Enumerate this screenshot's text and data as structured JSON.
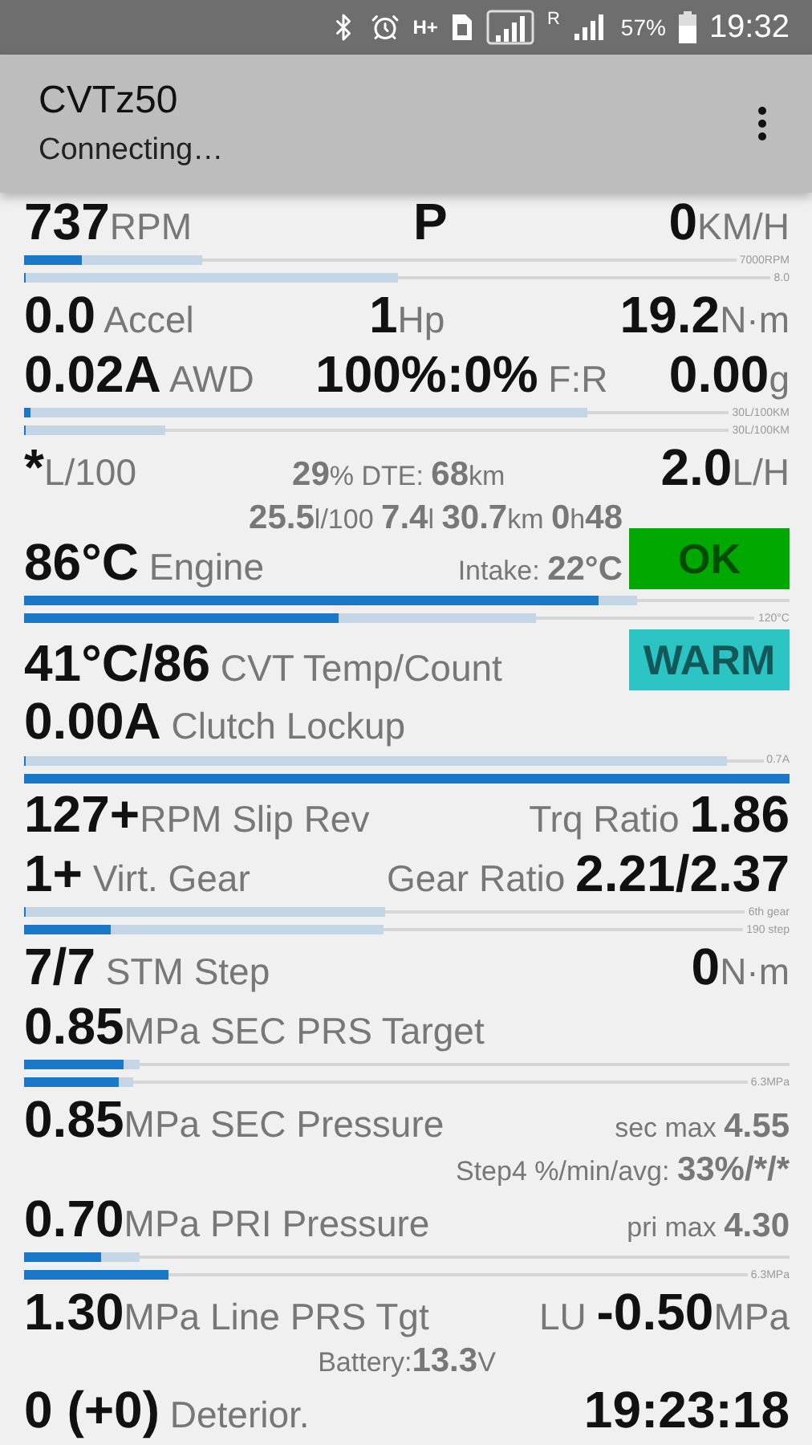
{
  "status_bar": {
    "network": "H+",
    "roaming": "R",
    "battery": "57%",
    "time": "19:32"
  },
  "app_bar": {
    "title": "CVTz50",
    "subtitle": "Connecting…"
  },
  "lines": [
    {
      "kind": "text",
      "left": [
        {
          "text": "737",
          "kind": "value"
        },
        {
          "text": "RPM",
          "kind": "unit"
        }
      ],
      "center": [
        {
          "text": "P",
          "kind": "value"
        }
      ],
      "right": [
        {
          "text": "0",
          "kind": "value"
        },
        {
          "text": "KM/H",
          "kind": "unit"
        }
      ]
    },
    {
      "kind": "bars",
      "bars": [
        {
          "peak": {
            "level": 0.25
          },
          "current": {
            "level": 0.08
          },
          "caption": "7000RPM"
        },
        {
          "peak": {
            "level": 0.5
          },
          "current": {
            "level": 0
          },
          "caption": "8.0"
        }
      ]
    },
    {
      "kind": "text",
      "left": [
        {
          "text": "0.0",
          "kind": "value"
        },
        {
          "text": " Accel",
          "kind": "unit"
        }
      ],
      "center": [
        {
          "text": "1",
          "kind": "value"
        },
        {
          "text": "Hp",
          "kind": "unit"
        }
      ],
      "right": [
        {
          "text": "19.2",
          "kind": "value"
        },
        {
          "text": "N·m",
          "kind": "unit"
        }
      ]
    },
    {
      "kind": "text",
      "left": [
        {
          "text": "0.02A",
          "kind": "value"
        },
        {
          "text": " AWD",
          "kind": "unit"
        }
      ],
      "center": [
        {
          "text": "100%:0%",
          "kind": "value"
        },
        {
          "text": " F:R",
          "kind": "unit"
        }
      ],
      "right": [
        {
          "text": "0.00",
          "kind": "value"
        },
        {
          "text": "g",
          "kind": "unit"
        }
      ]
    },
    {
      "kind": "bars",
      "bars": [
        {
          "peak": {
            "level": 0.8
          },
          "current": {
            "level": 0.01
          },
          "caption": "30L/100KM"
        },
        {
          "peak": {
            "level": 0.2
          },
          "current": {
            "level": 0
          },
          "caption": "30L/100KM"
        }
      ]
    },
    {
      "kind": "text",
      "left": [
        {
          "text": "*",
          "kind": "value"
        },
        {
          "text": "L/100",
          "kind": "unit"
        }
      ],
      "center": [
        {
          "text": "29",
          "kind": "small_value"
        },
        {
          "text": "% DTE: ",
          "kind": "small_unit"
        },
        {
          "text": "68",
          "kind": "small_value"
        },
        {
          "text": "km",
          "kind": "small_unit"
        }
      ],
      "right": [
        {
          "text": "2.0",
          "kind": "value"
        },
        {
          "text": "L/H",
          "kind": "unit"
        }
      ]
    },
    {
      "kind": "badged",
      "top": [
        {
          "text": "25.5",
          "kind": "small_value"
        },
        {
          "text": "l/100 ",
          "kind": "small_unit"
        },
        {
          "text": "7.4",
          "kind": "small_value"
        },
        {
          "text": "l ",
          "kind": "small_unit"
        },
        {
          "text": "30.7",
          "kind": "small_value"
        },
        {
          "text": "km ",
          "kind": "small_unit"
        },
        {
          "text": "0",
          "kind": "small_value"
        },
        {
          "text": "h",
          "kind": "small_unit"
        },
        {
          "text": "48",
          "kind": "small_value"
        }
      ],
      "left": [
        {
          "text": "86°C",
          "kind": "value"
        },
        {
          "text": " Engine",
          "kind": "unit"
        }
      ],
      "right": [
        {
          "text": "Intake: ",
          "kind": "small_unit"
        },
        {
          "text": "22°C",
          "kind": "small_value"
        }
      ],
      "badge": {
        "text": "OK",
        "color": "#00a800"
      }
    },
    {
      "kind": "bars",
      "bars": [
        {
          "peak": {
            "level": 0.8
          },
          "current": {
            "level": 0.75
          }
        },
        {
          "peak": {
            "level": 0.7
          },
          "current": {
            "level": 0.43
          },
          "caption": "120°C"
        }
      ]
    },
    {
      "kind": "badged",
      "left": [
        {
          "text": "41°C/86",
          "kind": "value"
        },
        {
          "text": " CVT Temp/Count",
          "kind": "unit"
        }
      ],
      "badge": {
        "text": "WARM",
        "color": "#2cc3c3"
      }
    },
    {
      "kind": "text",
      "left": [
        {
          "text": "0.00A",
          "kind": "value"
        },
        {
          "text": " Clutch Lockup",
          "kind": "unit"
        }
      ]
    },
    {
      "kind": "bars",
      "bars": [
        {
          "peak": {
            "level": 0.95
          },
          "current": {
            "level": 0
          },
          "caption": "0.7A"
        },
        {
          "current": {
            "level": 1
          }
        }
      ]
    },
    {
      "kind": "text",
      "left": [
        {
          "text": "127+",
          "kind": "value"
        },
        {
          "text": "RPM Slip Rev",
          "kind": "unit"
        }
      ],
      "right": [
        {
          "text": "Trq Ratio ",
          "kind": "unit"
        },
        {
          "text": "1.86",
          "kind": "value"
        }
      ]
    },
    {
      "kind": "text",
      "left": [
        {
          "text": "1+",
          "kind": "value"
        },
        {
          "text": " Virt. Gear",
          "kind": "unit"
        }
      ],
      "right": [
        {
          "text": "Gear Ratio ",
          "kind": "unit"
        },
        {
          "text": "2.21/2.37",
          "kind": "value"
        }
      ]
    },
    {
      "kind": "bars",
      "bars": [
        {
          "peak": {
            "level": 0.5
          },
          "current": {
            "level": 0
          },
          "caption": "6th gear"
        },
        {
          "peak": {
            "level": 0.5
          },
          "current": {
            "level": 0.12
          },
          "caption": "190 step"
        }
      ]
    },
    {
      "kind": "text",
      "left": [
        {
          "text": "7/7",
          "kind": "value"
        },
        {
          "text": " STM Step",
          "kind": "unit"
        }
      ],
      "right": [
        {
          "text": "0",
          "kind": "value"
        },
        {
          "text": "N·m",
          "kind": "unit"
        }
      ]
    },
    {
      "kind": "text",
      "left": [
        {
          "text": "0.85",
          "kind": "value"
        },
        {
          "text": "MPa SEC PRS Target",
          "kind": "unit"
        }
      ]
    },
    {
      "kind": "bars",
      "bars": [
        {
          "peak": {
            "level": 0.15
          },
          "current": {
            "level": 0.13
          }
        },
        {
          "peak": {
            "level": 0.15
          },
          "current": {
            "level": 0.13
          },
          "caption": "6.3MPa"
        }
      ]
    },
    {
      "kind": "text",
      "left": [
        {
          "text": "0.85",
          "kind": "value"
        },
        {
          "text": "MPa SEC Pressure",
          "kind": "unit"
        }
      ],
      "right": [
        {
          "text": "sec max ",
          "kind": "small_unit"
        },
        {
          "text": "4.55",
          "kind": "small_value"
        }
      ]
    },
    {
      "kind": "text",
      "right": [
        {
          "text": "Step4 %/min/avg: ",
          "kind": "small_unit"
        },
        {
          "text": "33%/*/*",
          "kind": "small_value"
        }
      ]
    },
    {
      "kind": "text",
      "left": [
        {
          "text": "0.70",
          "kind": "value"
        },
        {
          "text": "MPa PRI Pressure",
          "kind": "unit"
        }
      ],
      "right": [
        {
          "text": "pri max ",
          "kind": "small_unit"
        },
        {
          "text": "4.30",
          "kind": "small_value"
        }
      ]
    },
    {
      "kind": "bars",
      "bars": [
        {
          "peak": {
            "level": 0.15
          },
          "current": {
            "level": 0.1
          }
        },
        {
          "current": {
            "level": 0.2
          },
          "caption": "6.3MPa"
        }
      ]
    },
    {
      "kind": "text",
      "left": [
        {
          "text": "1.30",
          "kind": "value"
        },
        {
          "text": "MPa Line PRS Tgt",
          "kind": "unit"
        }
      ],
      "right": [
        {
          "text": "LU ",
          "kind": "unit"
        },
        {
          "text": "-0.50",
          "kind": "value"
        },
        {
          "text": "MPa",
          "kind": "unit"
        }
      ]
    },
    {
      "kind": "text",
      "center": [
        {
          "text": "Battery:",
          "kind": "small_unit"
        },
        {
          "text": "13.3",
          "kind": "small_value"
        },
        {
          "text": "V",
          "kind": "small_unit"
        }
      ]
    },
    {
      "kind": "text",
      "left": [
        {
          "text": "0 (+0)",
          "kind": "value"
        },
        {
          "text": " Deterior.",
          "kind": "unit"
        }
      ],
      "right": [
        {
          "text": "19:23:18",
          "kind": "value"
        }
      ]
    }
  ]
}
